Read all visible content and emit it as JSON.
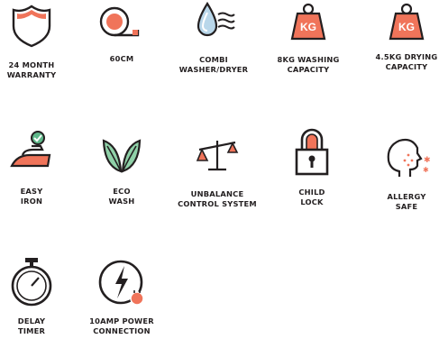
{
  "colors": {
    "ink": "#231f20",
    "accent": "#f0745a",
    "green": "#5fb88a",
    "leaf": "#8fd1a8"
  },
  "features": [
    {
      "icon": "shield-icon",
      "label": "24 MONTH\nWARRANTY"
    },
    {
      "icon": "measuring-tape-icon",
      "label": "60CM"
    },
    {
      "icon": "water-drop-wind-icon",
      "label": "COMBI\nWASHER/DRYER"
    },
    {
      "icon": "kg-weight-icon",
      "weight_text": "KG",
      "label": "8KG WASHING\nCAPACITY"
    },
    {
      "icon": "kg-weight-icon",
      "weight_text": "KG",
      "label": "4.5KG DRYING\nCAPACITY"
    },
    {
      "icon": "iron-icon",
      "label": "EASY\nIRON"
    },
    {
      "icon": "leaves-icon",
      "label": "ECO\nWASH"
    },
    {
      "icon": "balance-scale-icon",
      "label": "UNBALANCE\nCONTROL SYSTEM"
    },
    {
      "icon": "padlock-icon",
      "label": "CHILD\nLOCK"
    },
    {
      "icon": "allergy-head-icon",
      "label": "ALLERGY\nSAFE"
    },
    {
      "icon": "stopwatch-icon",
      "label": "DELAY\nTIMER"
    },
    {
      "icon": "power-plug-icon",
      "label": "10AMP POWER\nCONNECTION"
    }
  ]
}
